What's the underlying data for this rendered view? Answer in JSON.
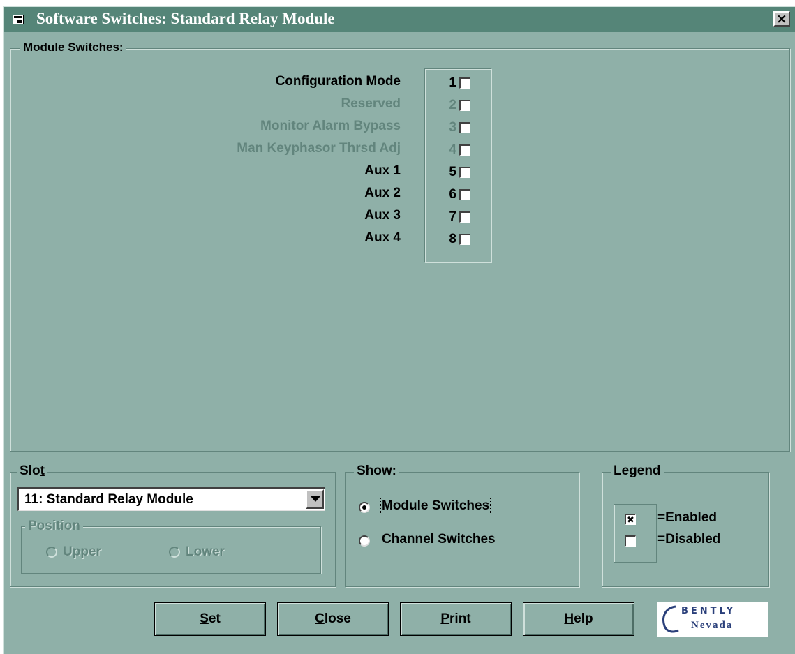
{
  "window": {
    "title": "Software Switches: Standard Relay Module",
    "close_glyph": "×"
  },
  "module_switches": {
    "label": "Module Switches:",
    "items": [
      {
        "label": "Configuration Mode",
        "number": "1",
        "enabled": true,
        "checked": false
      },
      {
        "label": "Reserved",
        "number": "2",
        "enabled": false,
        "checked": false
      },
      {
        "label": "Monitor Alarm Bypass",
        "number": "3",
        "enabled": false,
        "checked": false
      },
      {
        "label": "Man Keyphasor Thrsd Adj",
        "number": "4",
        "enabled": false,
        "checked": false
      },
      {
        "label": "Aux 1",
        "number": "5",
        "enabled": true,
        "checked": false
      },
      {
        "label": "Aux 2",
        "number": "6",
        "enabled": true,
        "checked": false
      },
      {
        "label": "Aux 3",
        "number": "7",
        "enabled": true,
        "checked": false
      },
      {
        "label": "Aux 4",
        "number": "8",
        "enabled": true,
        "checked": false
      }
    ]
  },
  "slot": {
    "label_pre": "Slo",
    "label_accel": "t",
    "selected": "11: Standard Relay Module",
    "position": {
      "label": "Position",
      "upper": "Upper",
      "lower": "Lower"
    }
  },
  "show": {
    "label": "Show:",
    "options": [
      {
        "label": "Module Switches",
        "selected": true
      },
      {
        "label": "Channel Switches",
        "selected": false
      }
    ]
  },
  "legend": {
    "label": "Legend",
    "enabled_text": "=Enabled",
    "disabled_text": "=Disabled",
    "enabled_mark": "✖"
  },
  "buttons": {
    "set": {
      "accel": "S",
      "rest": "et"
    },
    "close": {
      "accel": "C",
      "rest": "lose"
    },
    "print": {
      "accel": "P",
      "rest": "rint"
    },
    "help": {
      "accel": "H",
      "rest": "elp"
    }
  },
  "logo": {
    "text_top": "BENTLY",
    "text_bottom": "Nevada"
  },
  "colors": {
    "titlebar": "#558578",
    "window_bg": "#8fb0a8",
    "disabled_text": "#62857d"
  }
}
